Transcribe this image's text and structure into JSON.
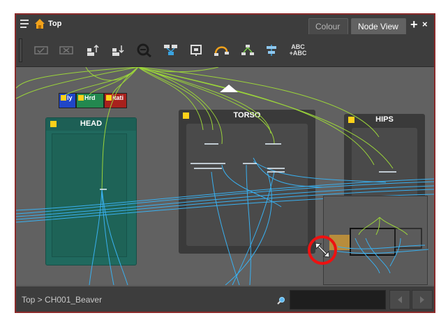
{
  "window": {
    "title": "Top",
    "tabs": [
      {
        "label": "Colour",
        "active": false
      },
      {
        "label": "Node View",
        "active": true
      }
    ],
    "add_label": "+",
    "close_label": "×"
  },
  "toolbar": {
    "buttons": [
      {
        "icon": "enable-node-icon"
      },
      {
        "icon": "disable-node-icon"
      },
      {
        "icon": "move-up-icon"
      },
      {
        "icon": "move-down-icon"
      },
      {
        "icon": "zoom-out-icon"
      },
      {
        "icon": "group-nodes-icon"
      },
      {
        "icon": "backdrop-icon"
      },
      {
        "icon": "cable-icon"
      },
      {
        "icon": "arrange-icon"
      },
      {
        "icon": "align-icon"
      },
      {
        "icon": "rename-icon",
        "label": "ABC\n+ABC"
      }
    ]
  },
  "canvas": {
    "backdrops": [
      {
        "name": "HEAD",
        "color": "#20695e"
      },
      {
        "name": "TORSO",
        "color": "#3a3a3a"
      },
      {
        "name": "HIPS",
        "color": "#3a3a3a"
      }
    ],
    "small_nodes": [
      "Eye",
      "Hand",
      "Station"
    ],
    "small_node_labels": [
      "ly",
      "Hrd",
      "itati"
    ]
  },
  "statusbar": {
    "breadcrumb": "Top > CH001_Beaver",
    "search_placeholder": ""
  },
  "colors": {
    "green_link": "#9bd43a",
    "blue_link": "#39b0f0",
    "highlight": "#e11111",
    "swatch": "#ffd11a"
  }
}
